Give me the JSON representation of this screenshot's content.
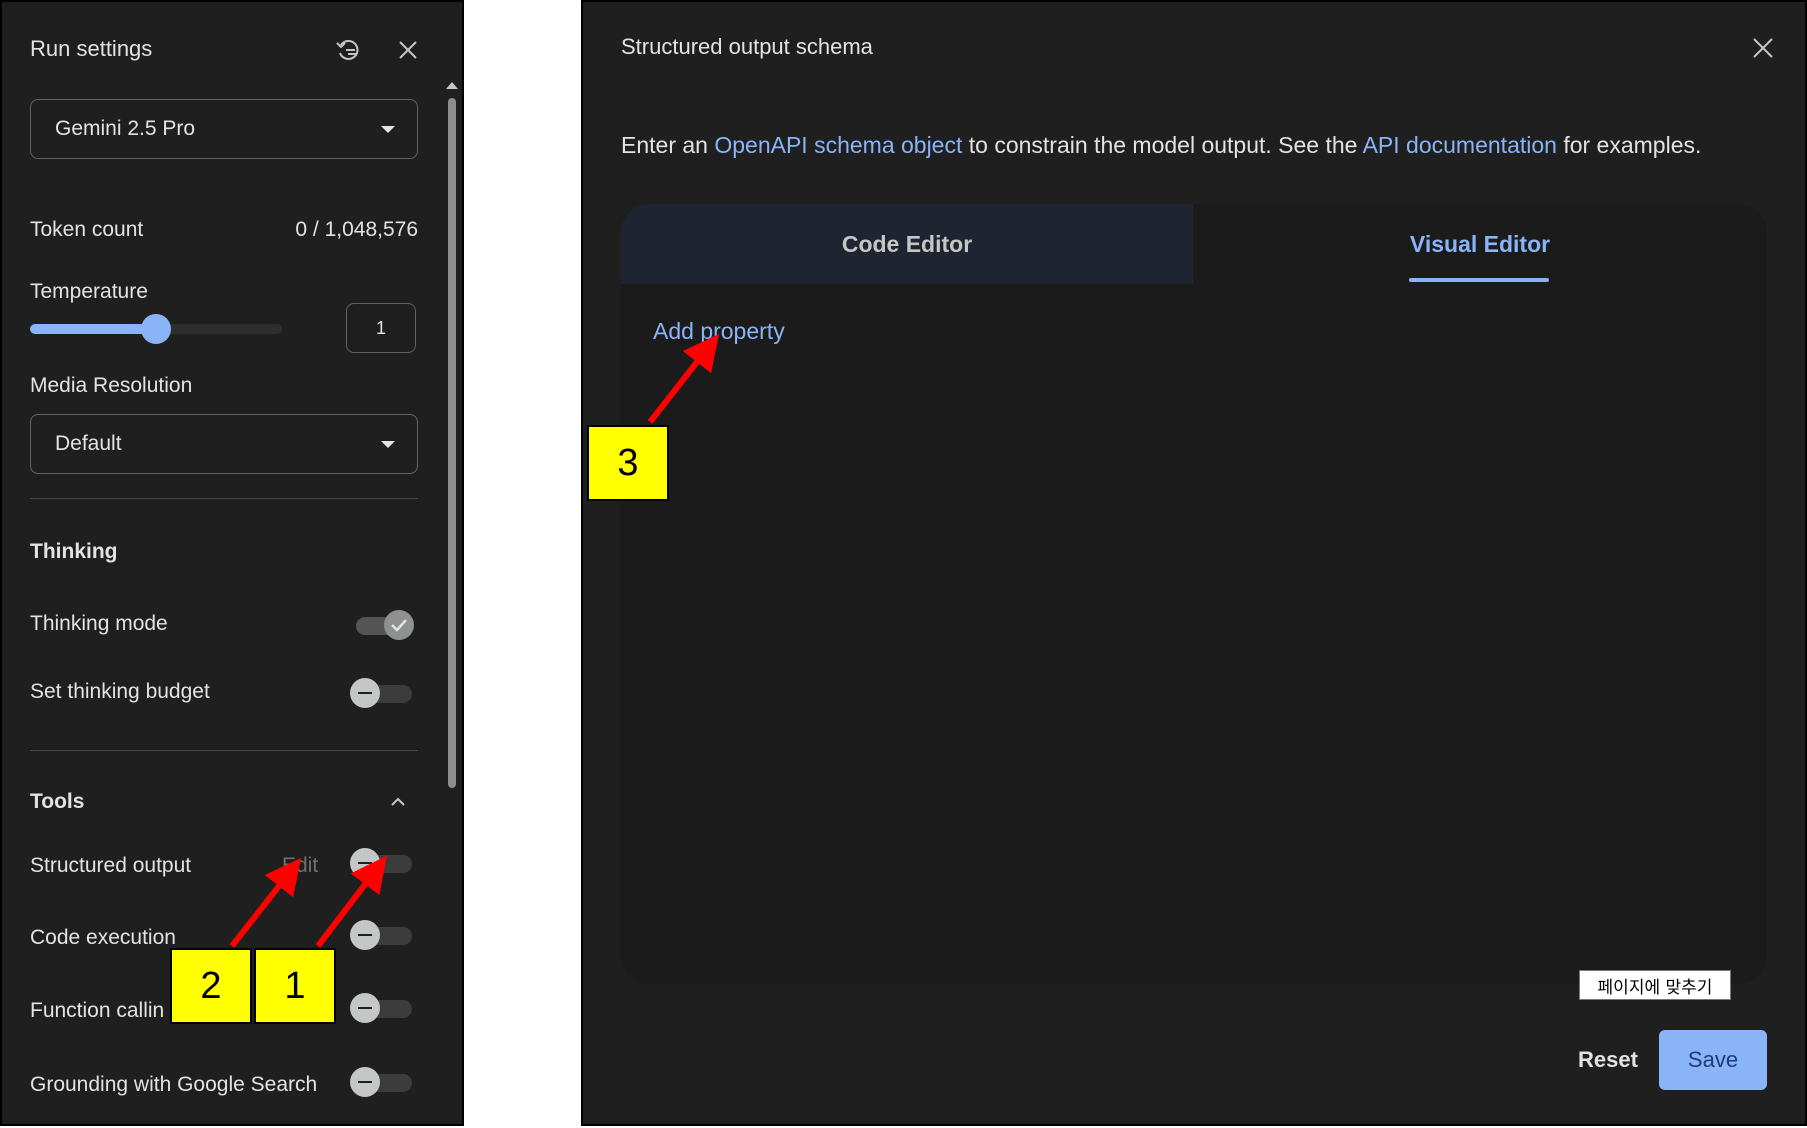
{
  "run_settings": {
    "title": "Run settings",
    "model": "Gemini 2.5 Pro",
    "token_count_label": "Token count",
    "token_count_value": "0 / 1,048,576",
    "temperature_label": "Temperature",
    "temperature_value": "1",
    "temperature_fraction": 0.5,
    "media_resolution_label": "Media Resolution",
    "media_resolution_value": "Default",
    "thinking_section": "Thinking",
    "thinking_mode_label": "Thinking mode",
    "thinking_mode_on": true,
    "thinking_budget_label": "Set thinking budget",
    "thinking_budget_on": false,
    "tools_section": "Tools",
    "tools": [
      {
        "label": "Structured output",
        "action": "Edit",
        "on": false
      },
      {
        "label": "Code execution",
        "on": false
      },
      {
        "label": "Function callin",
        "on": false
      },
      {
        "label": "Grounding with Google Search",
        "on": false
      }
    ]
  },
  "dialog": {
    "title": "Structured output schema",
    "desc_1": "Enter an ",
    "desc_link_1": "OpenAPI schema object",
    "desc_2": " to constrain the model output. See the ",
    "desc_link_2": "API documentation",
    "desc_3": " for examples.",
    "tabs": [
      {
        "label": "Code Editor",
        "active": false
      },
      {
        "label": "Visual Editor",
        "active": true
      }
    ],
    "add_property": "Add property",
    "tooltip": "페이지에 맞추기",
    "reset_label": "Reset",
    "save_label": "Save"
  },
  "callouts": [
    "1",
    "2",
    "3"
  ],
  "colors": {
    "accent": "#8ab4f8",
    "panel_bg": "#1f1f1f",
    "callout": "#ffff00",
    "arrow": "#ff0000"
  }
}
